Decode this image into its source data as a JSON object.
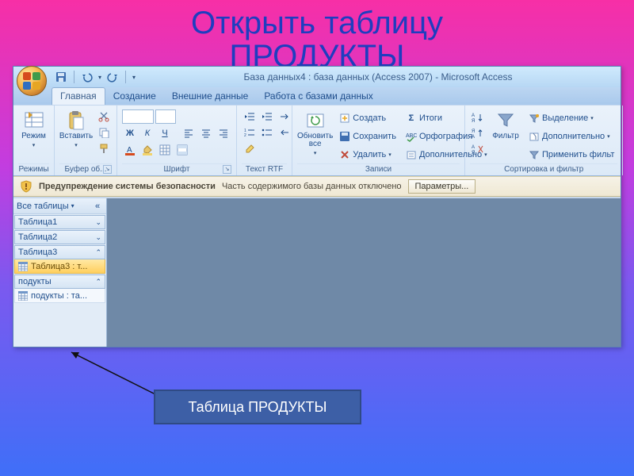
{
  "slide": {
    "title": "Открыть таблицу\nПРОДУКТЫ"
  },
  "window": {
    "title": "База данных4 : база данных (Access 2007) - Microsoft Access"
  },
  "tabs": {
    "home": "Главная",
    "create": "Создание",
    "external": "Внешние данные",
    "dbtools": "Работа с базами данных"
  },
  "ribbon": {
    "views": {
      "label": "Режимы",
      "view_btn": "Режим"
    },
    "clipboard": {
      "label": "Буфер об...",
      "paste": "Вставить"
    },
    "font": {
      "label": "Шрифт",
      "bold": "Ж",
      "italic": "К",
      "underline": "Ч"
    },
    "richtext": {
      "label": "Текст RTF"
    },
    "refresh": {
      "btn": "Обновить\nвсе"
    },
    "records": {
      "label": "Записи",
      "new": "Создать",
      "save": "Сохранить",
      "delete": "Удалить",
      "totals": "Итоги",
      "spelling": "Орфография",
      "more": "Дополнительно"
    },
    "sortfilter": {
      "label": "Сортировка и фильтр",
      "filter": "Фильтр",
      "selection": "Выделение",
      "advanced": "Дополнительно",
      "toggle": "Применить фильт"
    }
  },
  "security": {
    "title": "Предупреждение системы безопасности",
    "msg": "Часть содержимого базы данных отключено",
    "btn": "Параметры..."
  },
  "nav": {
    "header": "Все таблицы",
    "cats": {
      "t1": "Таблица1",
      "t2": "Таблица2",
      "t3": "Таблица3",
      "p": "подукты"
    },
    "items": {
      "t3": "Таблица3 : т...",
      "p": "подукты : та..."
    }
  },
  "callout": {
    "text": "Таблица ПРОДУКТЫ"
  }
}
